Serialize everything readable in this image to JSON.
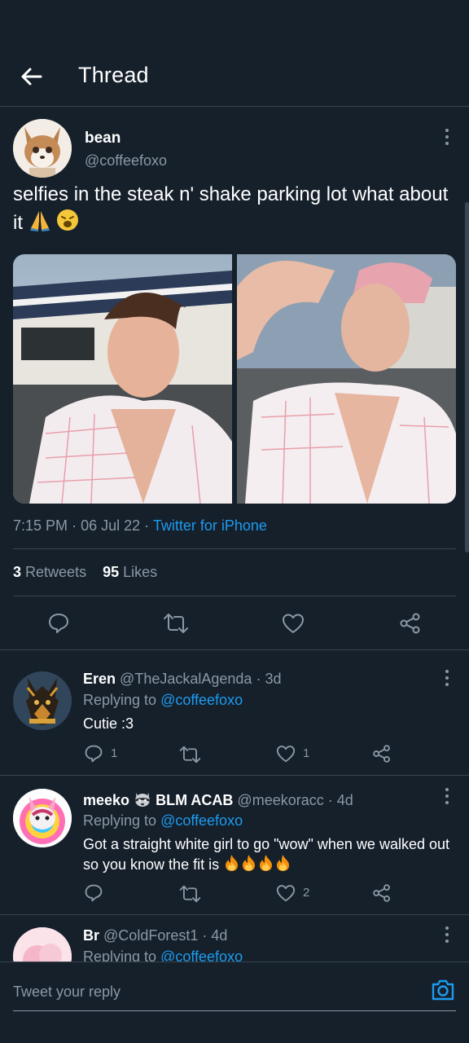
{
  "header": {
    "title": "Thread"
  },
  "tweet": {
    "author_name": "bean",
    "author_handle": "@coffeefoxo",
    "text": "selfies in the steak n' shake parking lot what about it",
    "time": "7:15 PM",
    "date": "06 Jul 22",
    "source": "Twitter for iPhone",
    "retweets_count": "3",
    "retweets_label": "Retweets",
    "likes_count": "95",
    "likes_label": "Likes"
  },
  "replies": [
    {
      "name": "Eren",
      "handle": "@TheJackalAgenda",
      "time": "3d",
      "replying_label": "Replying to",
      "replying_to": "@coffeefoxo",
      "text": "Cutie :3",
      "reply_count": "1",
      "retweet_count": "",
      "like_count": "1"
    },
    {
      "name": "meeko",
      "name_suffix": "BLM ACAB",
      "handle": "@meekoracc",
      "time": "4d",
      "replying_label": "Replying to",
      "replying_to": "@coffeefoxo",
      "text": "Got a straight white girl to go \"wow\" when we walked out so you know the fit is",
      "reply_count": "",
      "retweet_count": "",
      "like_count": "2"
    },
    {
      "name": "Br",
      "handle": "@ColdForest1",
      "time": "4d",
      "replying_label": "Replying to",
      "replying_to": "@coffeefoxo"
    }
  ],
  "composer": {
    "placeholder": "Tweet your reply"
  },
  "colors": {
    "background": "#15202b",
    "accent": "#1d9bf0",
    "muted": "#8b98a5",
    "divider": "#38444d"
  },
  "icons": [
    "back-arrow-icon",
    "more-icon",
    "reply-icon",
    "retweet-icon",
    "like-icon",
    "share-icon",
    "camera-icon",
    "praying-hands-emoji",
    "weary-face-emoji",
    "raccoon-emoji",
    "fire-emoji"
  ]
}
